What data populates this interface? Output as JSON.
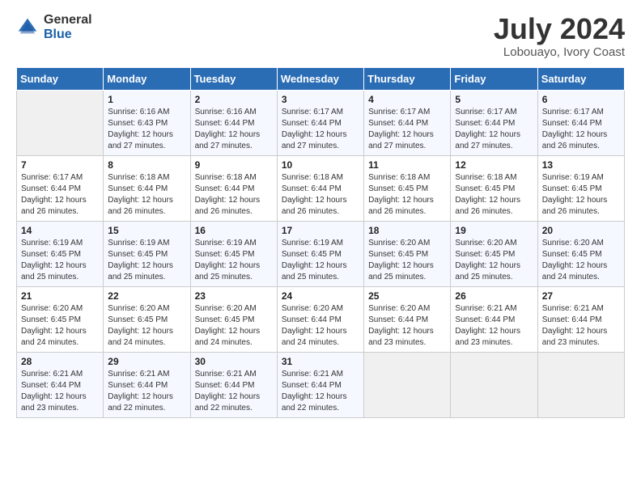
{
  "header": {
    "logo_general": "General",
    "logo_blue": "Blue",
    "month_year": "July 2024",
    "location": "Lobouayo, Ivory Coast"
  },
  "weekdays": [
    "Sunday",
    "Monday",
    "Tuesday",
    "Wednesday",
    "Thursday",
    "Friday",
    "Saturday"
  ],
  "weeks": [
    [
      {
        "day": "",
        "sunrise": "",
        "sunset": "",
        "daylight": ""
      },
      {
        "day": "1",
        "sunrise": "Sunrise: 6:16 AM",
        "sunset": "Sunset: 6:43 PM",
        "daylight": "Daylight: 12 hours and 27 minutes."
      },
      {
        "day": "2",
        "sunrise": "Sunrise: 6:16 AM",
        "sunset": "Sunset: 6:44 PM",
        "daylight": "Daylight: 12 hours and 27 minutes."
      },
      {
        "day": "3",
        "sunrise": "Sunrise: 6:17 AM",
        "sunset": "Sunset: 6:44 PM",
        "daylight": "Daylight: 12 hours and 27 minutes."
      },
      {
        "day": "4",
        "sunrise": "Sunrise: 6:17 AM",
        "sunset": "Sunset: 6:44 PM",
        "daylight": "Daylight: 12 hours and 27 minutes."
      },
      {
        "day": "5",
        "sunrise": "Sunrise: 6:17 AM",
        "sunset": "Sunset: 6:44 PM",
        "daylight": "Daylight: 12 hours and 27 minutes."
      },
      {
        "day": "6",
        "sunrise": "Sunrise: 6:17 AM",
        "sunset": "Sunset: 6:44 PM",
        "daylight": "Daylight: 12 hours and 26 minutes."
      }
    ],
    [
      {
        "day": "7",
        "sunrise": "Sunrise: 6:17 AM",
        "sunset": "Sunset: 6:44 PM",
        "daylight": "Daylight: 12 hours and 26 minutes."
      },
      {
        "day": "8",
        "sunrise": "Sunrise: 6:18 AM",
        "sunset": "Sunset: 6:44 PM",
        "daylight": "Daylight: 12 hours and 26 minutes."
      },
      {
        "day": "9",
        "sunrise": "Sunrise: 6:18 AM",
        "sunset": "Sunset: 6:44 PM",
        "daylight": "Daylight: 12 hours and 26 minutes."
      },
      {
        "day": "10",
        "sunrise": "Sunrise: 6:18 AM",
        "sunset": "Sunset: 6:44 PM",
        "daylight": "Daylight: 12 hours and 26 minutes."
      },
      {
        "day": "11",
        "sunrise": "Sunrise: 6:18 AM",
        "sunset": "Sunset: 6:45 PM",
        "daylight": "Daylight: 12 hours and 26 minutes."
      },
      {
        "day": "12",
        "sunrise": "Sunrise: 6:18 AM",
        "sunset": "Sunset: 6:45 PM",
        "daylight": "Daylight: 12 hours and 26 minutes."
      },
      {
        "day": "13",
        "sunrise": "Sunrise: 6:19 AM",
        "sunset": "Sunset: 6:45 PM",
        "daylight": "Daylight: 12 hours and 26 minutes."
      }
    ],
    [
      {
        "day": "14",
        "sunrise": "Sunrise: 6:19 AM",
        "sunset": "Sunset: 6:45 PM",
        "daylight": "Daylight: 12 hours and 25 minutes."
      },
      {
        "day": "15",
        "sunrise": "Sunrise: 6:19 AM",
        "sunset": "Sunset: 6:45 PM",
        "daylight": "Daylight: 12 hours and 25 minutes."
      },
      {
        "day": "16",
        "sunrise": "Sunrise: 6:19 AM",
        "sunset": "Sunset: 6:45 PM",
        "daylight": "Daylight: 12 hours and 25 minutes."
      },
      {
        "day": "17",
        "sunrise": "Sunrise: 6:19 AM",
        "sunset": "Sunset: 6:45 PM",
        "daylight": "Daylight: 12 hours and 25 minutes."
      },
      {
        "day": "18",
        "sunrise": "Sunrise: 6:20 AM",
        "sunset": "Sunset: 6:45 PM",
        "daylight": "Daylight: 12 hours and 25 minutes."
      },
      {
        "day": "19",
        "sunrise": "Sunrise: 6:20 AM",
        "sunset": "Sunset: 6:45 PM",
        "daylight": "Daylight: 12 hours and 25 minutes."
      },
      {
        "day": "20",
        "sunrise": "Sunrise: 6:20 AM",
        "sunset": "Sunset: 6:45 PM",
        "daylight": "Daylight: 12 hours and 24 minutes."
      }
    ],
    [
      {
        "day": "21",
        "sunrise": "Sunrise: 6:20 AM",
        "sunset": "Sunset: 6:45 PM",
        "daylight": "Daylight: 12 hours and 24 minutes."
      },
      {
        "day": "22",
        "sunrise": "Sunrise: 6:20 AM",
        "sunset": "Sunset: 6:45 PM",
        "daylight": "Daylight: 12 hours and 24 minutes."
      },
      {
        "day": "23",
        "sunrise": "Sunrise: 6:20 AM",
        "sunset": "Sunset: 6:45 PM",
        "daylight": "Daylight: 12 hours and 24 minutes."
      },
      {
        "day": "24",
        "sunrise": "Sunrise: 6:20 AM",
        "sunset": "Sunset: 6:44 PM",
        "daylight": "Daylight: 12 hours and 24 minutes."
      },
      {
        "day": "25",
        "sunrise": "Sunrise: 6:20 AM",
        "sunset": "Sunset: 6:44 PM",
        "daylight": "Daylight: 12 hours and 23 minutes."
      },
      {
        "day": "26",
        "sunrise": "Sunrise: 6:21 AM",
        "sunset": "Sunset: 6:44 PM",
        "daylight": "Daylight: 12 hours and 23 minutes."
      },
      {
        "day": "27",
        "sunrise": "Sunrise: 6:21 AM",
        "sunset": "Sunset: 6:44 PM",
        "daylight": "Daylight: 12 hours and 23 minutes."
      }
    ],
    [
      {
        "day": "28",
        "sunrise": "Sunrise: 6:21 AM",
        "sunset": "Sunset: 6:44 PM",
        "daylight": "Daylight: 12 hours and 23 minutes."
      },
      {
        "day": "29",
        "sunrise": "Sunrise: 6:21 AM",
        "sunset": "Sunset: 6:44 PM",
        "daylight": "Daylight: 12 hours and 22 minutes."
      },
      {
        "day": "30",
        "sunrise": "Sunrise: 6:21 AM",
        "sunset": "Sunset: 6:44 PM",
        "daylight": "Daylight: 12 hours and 22 minutes."
      },
      {
        "day": "31",
        "sunrise": "Sunrise: 6:21 AM",
        "sunset": "Sunset: 6:44 PM",
        "daylight": "Daylight: 12 hours and 22 minutes."
      },
      {
        "day": "",
        "sunrise": "",
        "sunset": "",
        "daylight": ""
      },
      {
        "day": "",
        "sunrise": "",
        "sunset": "",
        "daylight": ""
      },
      {
        "day": "",
        "sunrise": "",
        "sunset": "",
        "daylight": ""
      }
    ]
  ]
}
